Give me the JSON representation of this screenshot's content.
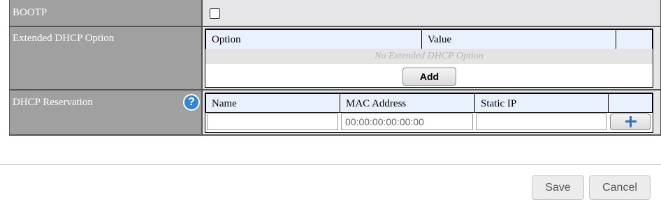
{
  "form": {
    "bootp_label": "BOOTP",
    "ext_dhcp_label": "Extended DHCP Option",
    "ext_dhcp_table": {
      "columns": [
        "Option",
        "Value",
        ""
      ],
      "empty_text": "No Extended DHCP Option",
      "add_label": "Add"
    },
    "reservation_label": "DHCP Reservation",
    "reservation_table": {
      "columns": [
        "Name",
        "MAC Address",
        "Static IP",
        ""
      ],
      "mac_placeholder": "00:00:00:00:00:00",
      "add_icon": "plus-icon"
    },
    "help_icon": "question-icon"
  },
  "footer": {
    "save_label": "Save",
    "cancel_label": "Cancel"
  },
  "colors": {
    "label_bg": "#a0a0a0",
    "value_bg": "#e6e5e8",
    "header_bg": "#e8f1fc",
    "accent": "#2f87d8"
  }
}
